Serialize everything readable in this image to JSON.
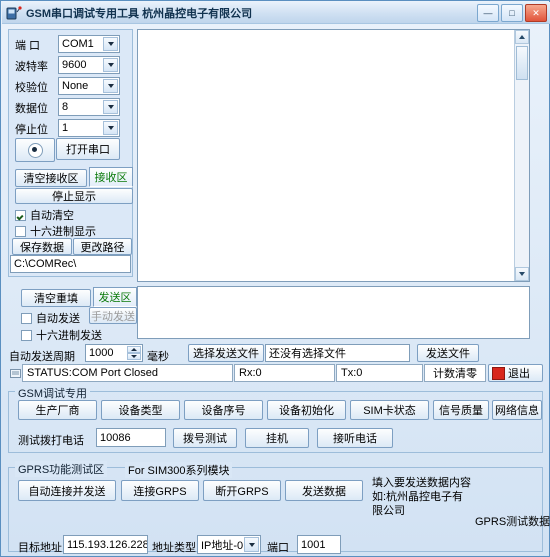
{
  "window": {
    "title": "GSM串口调试专用工具 杭州晶控电子有限公司",
    "buttons": {
      "minimize": "—",
      "maximize": "□",
      "close": "✕"
    }
  },
  "serial": {
    "labels": {
      "port": "端 口",
      "baud": "波特率",
      "parity": "校验位",
      "data_bits": "数据位",
      "stop_bits": "停止位"
    },
    "port": "COM1",
    "baud": "9600",
    "parity": "None",
    "data_bits": "8",
    "stop_bits": "1",
    "open_button": "打开串口"
  },
  "receive": {
    "clear_button": "清空接收区",
    "tab_label": "接收区",
    "stop_button": "停止显示",
    "auto_clear": "自动清空",
    "hex_display": "十六进制显示",
    "save_data": "保存数据",
    "change_path": "更改路径",
    "path": "C:\\COMRec\\",
    "content": ""
  },
  "send": {
    "clear_button": "清空重填",
    "tab_label": "发送区",
    "auto_send": "自动发送",
    "manual_send": "手动发送",
    "hex_send": "十六进制发送",
    "period_label": "自动发送周期",
    "period_value": "1000",
    "period_unit": "毫秒",
    "select_file_button": "选择发送文件",
    "file_value": "还没有选择文件",
    "send_file_button": "发送文件",
    "content": ""
  },
  "status": {
    "text": "STATUS:COM Port Closed",
    "rx": "Rx:0",
    "tx": "Tx:0",
    "reset_counter": "计数清零",
    "exit": "退出"
  },
  "gsm_group": {
    "title": "GSM调试专用",
    "buttons": [
      "生产厂商",
      "设备类型",
      "设备序号",
      "设备初始化",
      "SIM卡状态",
      "信号质量",
      "网络信息"
    ],
    "dial_label": "测试拨打电话",
    "dial_number": "10086",
    "dial_button": "拨号测试",
    "hangup_button": "挂机",
    "answer_button": "接听电话"
  },
  "gprs_group": {
    "title": "GPRS功能测试区",
    "subtitle": "For SIM300系列模块",
    "auto_connect_send": "自动连接并发送",
    "connect_gprs": "连接GRPS",
    "disconnect_gprs": "断开GRPS",
    "send_data": "发送数据",
    "hint_line1": "填入要发送数据内容",
    "hint_line2": "如:杭州晶控电子有限公司",
    "packet_label": "GPRS测试数据包",
    "packet_value": "",
    "target_label": "目标地址",
    "target_value": "115.193.126.228",
    "addr_type_label": "地址类型",
    "addr_type_value": "IP地址-0",
    "port_label": "端口",
    "port_value": "1001"
  }
}
